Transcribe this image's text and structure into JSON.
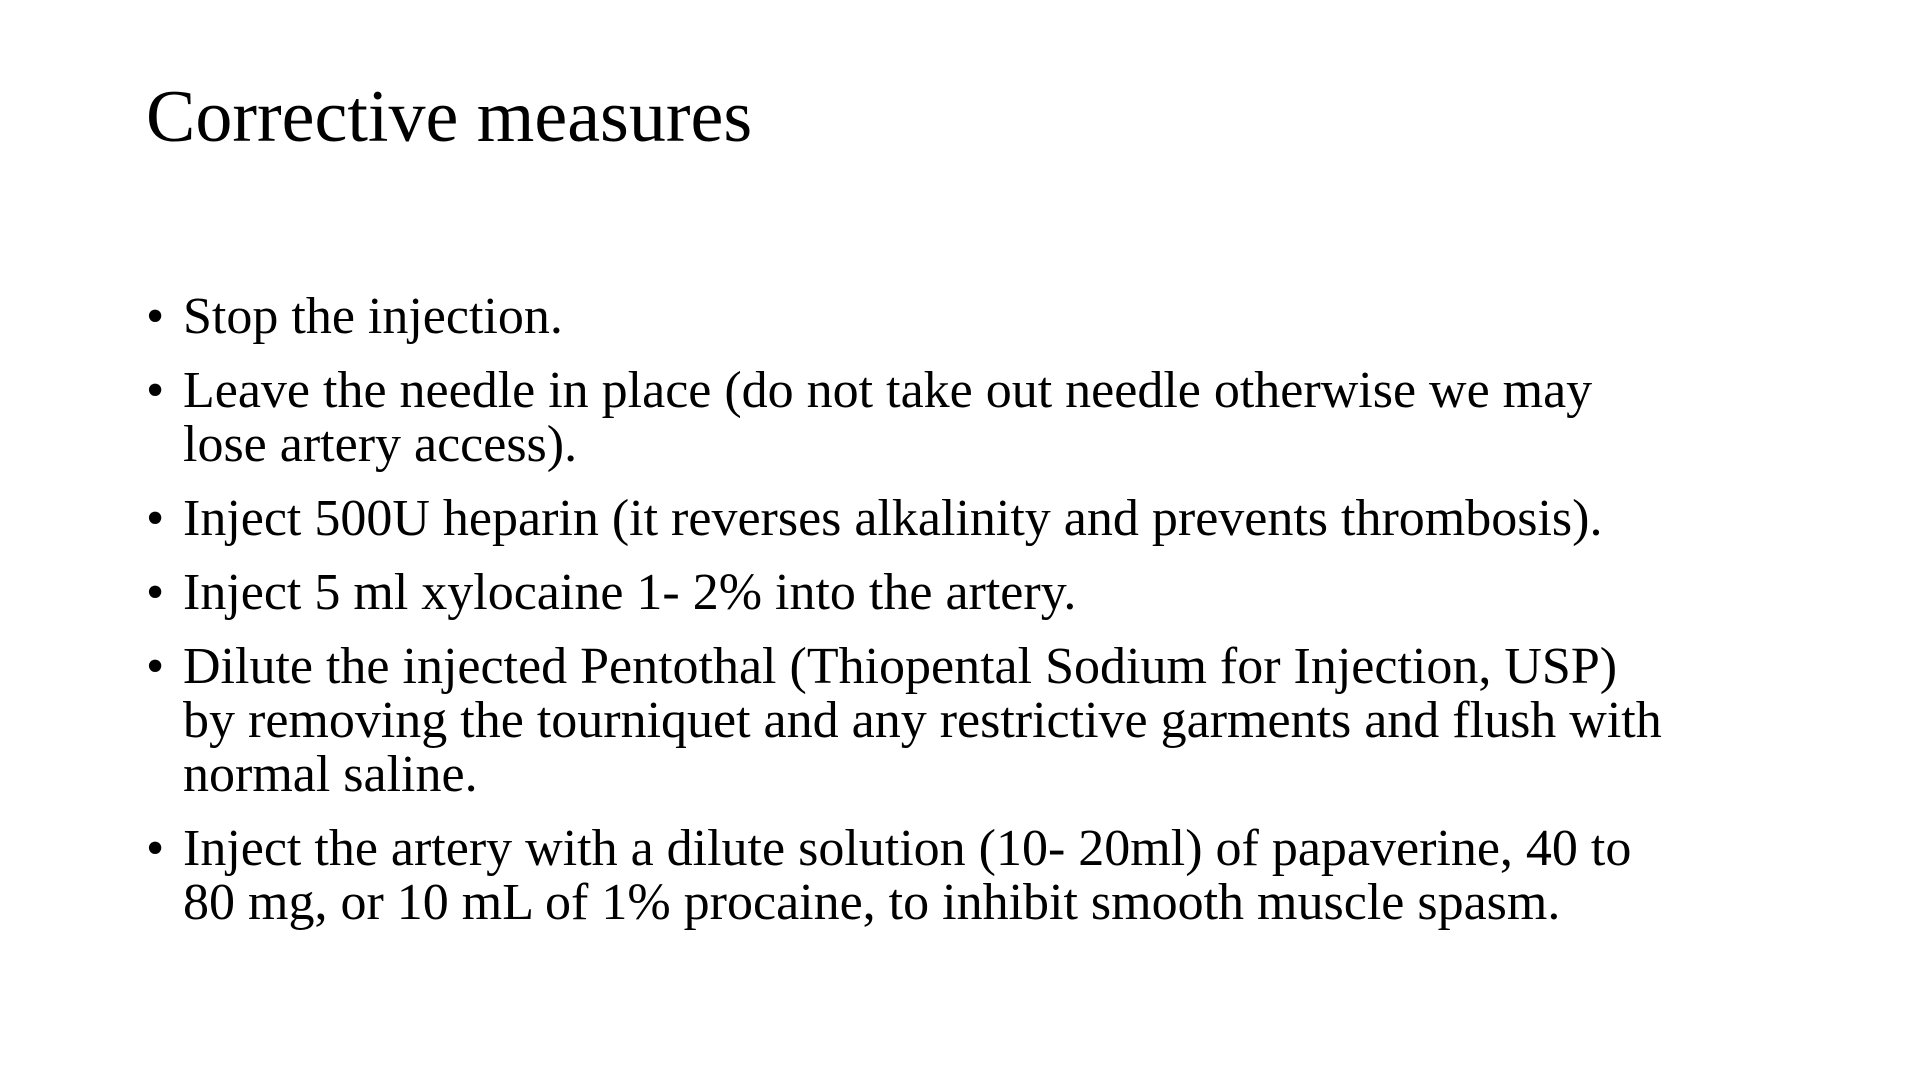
{
  "slide": {
    "title": "Corrective measures",
    "bullet_symbol": "•",
    "items": [
      {
        "lines": [
          "Stop the injection."
        ]
      },
      {
        "lines": [
          "Leave the needle in place (do not take out needle otherwise we may",
          "lose artery access)."
        ]
      },
      {
        "lines": [
          "Inject 500U heparin (it reverses alkalinity and prevents thrombosis)."
        ]
      },
      {
        "lines": [
          "Inject 5 ml xylocaine 1- 2% into the artery."
        ]
      },
      {
        "lines": [
          "Dilute the injected Pentothal (Thiopental Sodium for Injection, USP)",
          "by removing the tourniquet and any restrictive garments and flush with",
          "normal saline."
        ]
      },
      {
        "lines": [
          "Inject the artery with a dilute solution (10- 20ml) of papaverine, 40 to",
          "80 mg, or 10 mL of 1% procaine, to inhibit smooth muscle spasm."
        ]
      }
    ]
  }
}
